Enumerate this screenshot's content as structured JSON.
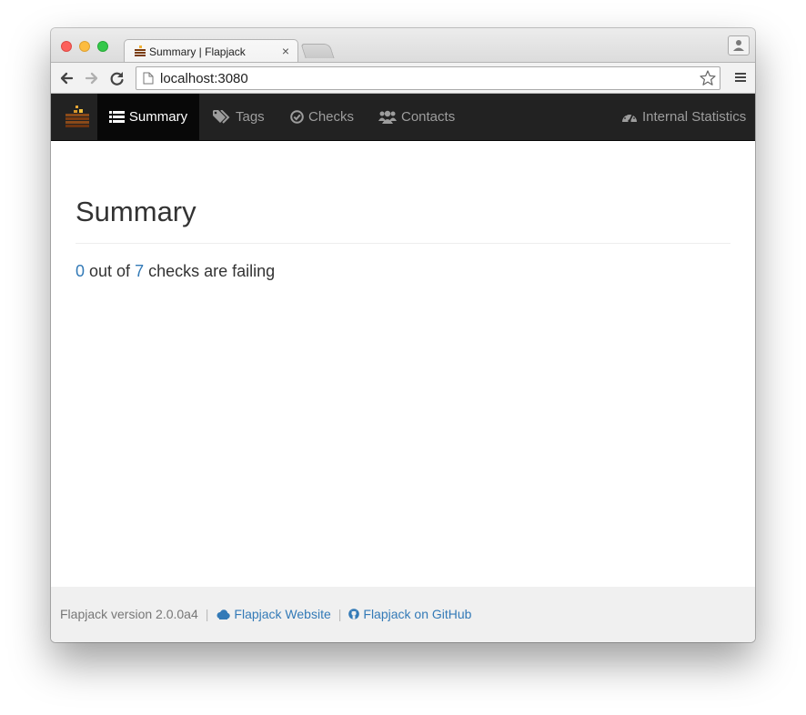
{
  "browser": {
    "tab_title": "Summary | Flapjack",
    "url": "localhost:3080"
  },
  "navbar": {
    "items": [
      {
        "label": "Summary",
        "icon": "list-icon",
        "active": true
      },
      {
        "label": "Tags",
        "icon": "tags-icon",
        "active": false
      },
      {
        "label": "Checks",
        "icon": "check-circle-icon",
        "active": false
      },
      {
        "label": "Contacts",
        "icon": "users-icon",
        "active": false
      }
    ],
    "right_item": {
      "label": "Internal Statistics",
      "icon": "dashboard-icon"
    }
  },
  "main": {
    "title": "Summary",
    "failing_count": "0",
    "text_out_of": " out of ",
    "total_count": "7",
    "text_suffix": " checks are failing"
  },
  "footer": {
    "version": "Flapjack version 2.0.0a4",
    "website_link": "Flapjack Website",
    "github_link": "Flapjack on GitHub"
  },
  "colors": {
    "navbar_bg": "#222222",
    "link": "#337ab7",
    "brand_orange": "#e8a735"
  }
}
